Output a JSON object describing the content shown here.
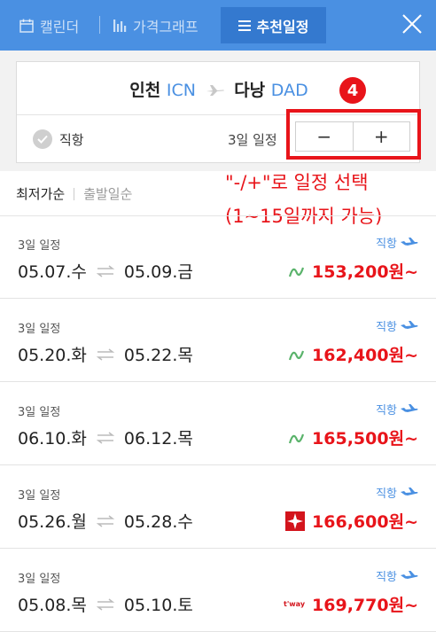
{
  "tabs": {
    "calendar": "캘린더",
    "price_graph": "가격그래프",
    "recommended": "추천일정"
  },
  "route": {
    "origin_city": "인천",
    "origin_code": "ICN",
    "dest_city": "다낭",
    "dest_code": "DAD"
  },
  "filter": {
    "direct_label": "직항",
    "trip_days_label": "3일 일정",
    "minus": "−",
    "plus": "+"
  },
  "annotation": {
    "number": "4",
    "line1": "\"-/+\"로 일정 선택",
    "line2": "(1~15일까지 가능)",
    "color": "#e8141a"
  },
  "sort": {
    "lowest_price": "최저가순",
    "departure_date": "출발일순"
  },
  "results": [
    {
      "days": "3일 일정",
      "direct": "직항",
      "depart": "05.07.수",
      "return": "05.09.금",
      "airline_logo": "tway-style-green-logo",
      "price": "153,200원~"
    },
    {
      "days": "3일 일정",
      "direct": "직항",
      "depart": "05.20.화",
      "return": "05.22.목",
      "airline_logo": "tway-style-green-logo",
      "price": "162,400원~"
    },
    {
      "days": "3일 일정",
      "direct": "직항",
      "depart": "06.10.화",
      "return": "06.12.목",
      "airline_logo": "tway-style-green-logo",
      "price": "165,500원~"
    },
    {
      "days": "3일 일정",
      "direct": "직항",
      "depart": "05.26.월",
      "return": "05.28.수",
      "airline_logo": "red-star-logo",
      "price": "166,600원~"
    },
    {
      "days": "3일 일정",
      "direct": "직항",
      "depart": "05.08.목",
      "return": "05.10.토",
      "airline_logo": "tway-text-logo",
      "logo_text": "t'way",
      "price": "169,770원~"
    }
  ],
  "colors": {
    "topbar": "#4a90e2",
    "active_tab": "#3479cf",
    "price": "#e8141a",
    "accent_blue": "#4a90e2"
  }
}
